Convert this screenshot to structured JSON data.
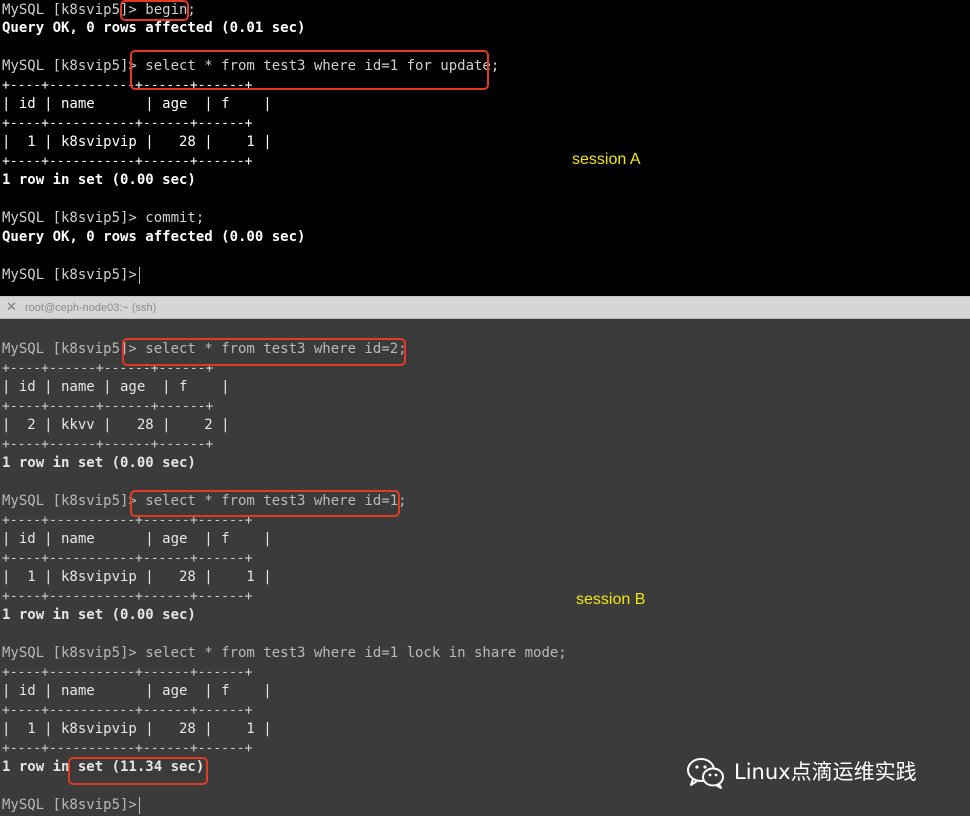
{
  "session_a": {
    "lines": [
      "MySQL [k8svip5]> begin;",
      "Query OK, 0 rows affected (0.01 sec)",
      "MySQL [k8svip5]> select * from test3 where id=1 for update;",
      "+----+-----------+------+------+",
      "| id | name      | age  | f    |",
      "+----+-----------+------+------+",
      "|  1 | k8svipvip |   28 |    1 |",
      "+----+-----------+------+------+",
      "1 row in set (0.00 sec)",
      "MySQL [k8svip5]> commit;",
      "Query OK, 0 rows affected (0.00 sec)",
      "MySQL [k8svip5]> "
    ],
    "label": "session A"
  },
  "tab": {
    "close": "✕",
    "title": "root@ceph-node03:~ (ssh)"
  },
  "session_b": {
    "lines": [
      "MySQL [k8svip5]> select * from test3 where id=2;",
      "+----+------+------+------+",
      "| id | name | age  | f    |",
      "+----+------+------+------+",
      "|  2 | kkvv |   28 |    2 |",
      "+----+------+------+------+",
      "1 row in set (0.00 sec)",
      "MySQL [k8svip5]> select * from test3 where id=1;",
      "+----+-----------+------+------+",
      "| id | name      | age  | f    |",
      "+----+-----------+------+------+",
      "|  1 | k8svipvip |   28 |    1 |",
      "+----+-----------+------+------+",
      "1 row in set (0.00 sec)",
      "MySQL [k8svip5]> select * from test3 where id=1 lock in share mode;",
      "+----+-----------+------+------+",
      "| id | name      | age  | f    |",
      "+----+-----------+------+------+",
      "|  1 | k8svipvip |   28 |    1 |",
      "+----+-----------+------+------+",
      "1 row in set (11.34 sec)",
      "MySQL [k8svip5]> "
    ],
    "label": "session B"
  },
  "watermark": {
    "icon": "wechat-icon",
    "text": "Linux点滴运维实践"
  },
  "colors": {
    "highlight": "#e03c25",
    "session_label": "#f2e60c",
    "pane_a_bg": "#000000",
    "pane_b_bg": "#3b3b3b"
  }
}
